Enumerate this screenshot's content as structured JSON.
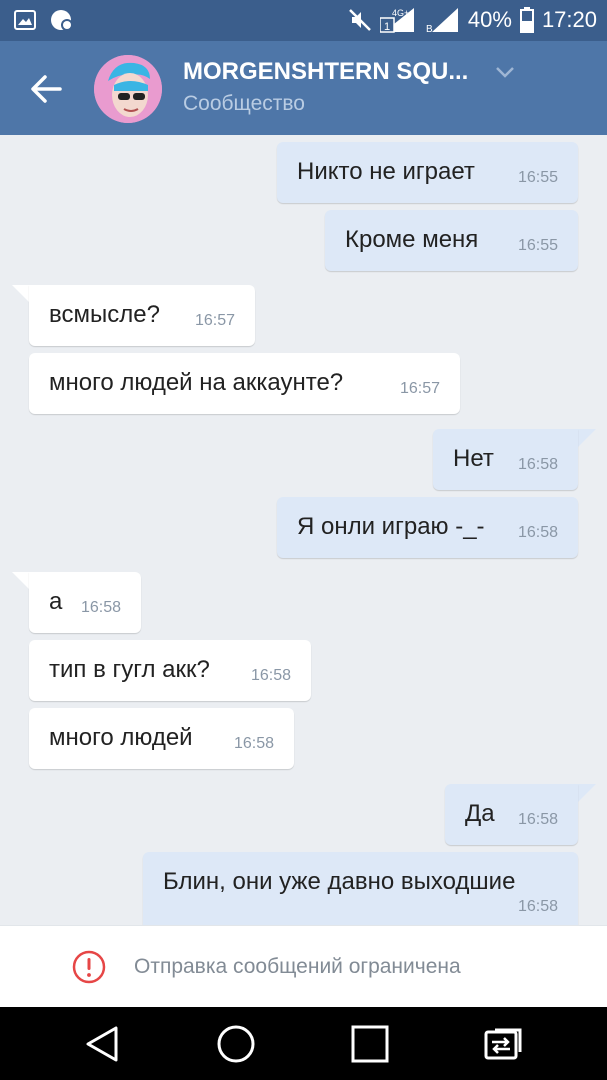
{
  "status_bar": {
    "battery": "40%",
    "time": "17:20",
    "network_label": "4G+",
    "sim1": "1",
    "sim2": "B"
  },
  "header": {
    "title": "MORGENSHTERN SQU...",
    "subtitle": "Сообщество",
    "avatar_colors": [
      "#e99bcf",
      "#3ab5e4"
    ]
  },
  "messages": [
    {
      "dir": "out",
      "text": "Никто не играет",
      "time": "16:55",
      "tail": false
    },
    {
      "dir": "out",
      "text": "Кроме меня",
      "time": "16:55",
      "tail": false
    },
    {
      "dir": "in",
      "text": "всмысле?",
      "time": "16:57",
      "tail": true
    },
    {
      "dir": "in",
      "text": "много людей на аккаунте?",
      "time": "16:57",
      "tail": false
    },
    {
      "dir": "out",
      "text": "Нет",
      "time": "16:58",
      "tail": true
    },
    {
      "dir": "out",
      "text": "Я онли играю -_-",
      "time": "16:58",
      "tail": false
    },
    {
      "dir": "in",
      "text": "а",
      "time": "16:58",
      "tail": true
    },
    {
      "dir": "in",
      "text": "тип в гугл акк?",
      "time": "16:58",
      "tail": false
    },
    {
      "dir": "in",
      "text": "много людей",
      "time": "16:58",
      "tail": false
    },
    {
      "dir": "out",
      "text": "Да",
      "time": "16:58",
      "tail": true
    },
    {
      "dir": "out",
      "text": "Блин, они уже давно выходшие",
      "time": "16:58",
      "tail": false
    }
  ],
  "footer": {
    "text": "Отправка сообщений ограничена",
    "icon": "warning-circle-icon",
    "icon_color": "#e64646"
  },
  "navbar": {
    "icons": [
      "back-triangle-icon",
      "home-circle-icon",
      "recents-square-icon",
      "switch-apps-icon"
    ]
  },
  "colors": {
    "status_bar": "#3b5e8c",
    "header": "#4e76a8",
    "background": "#ebeef2",
    "outgoing_bubble": "#dde8f7",
    "incoming_bubble": "#ffffff"
  }
}
